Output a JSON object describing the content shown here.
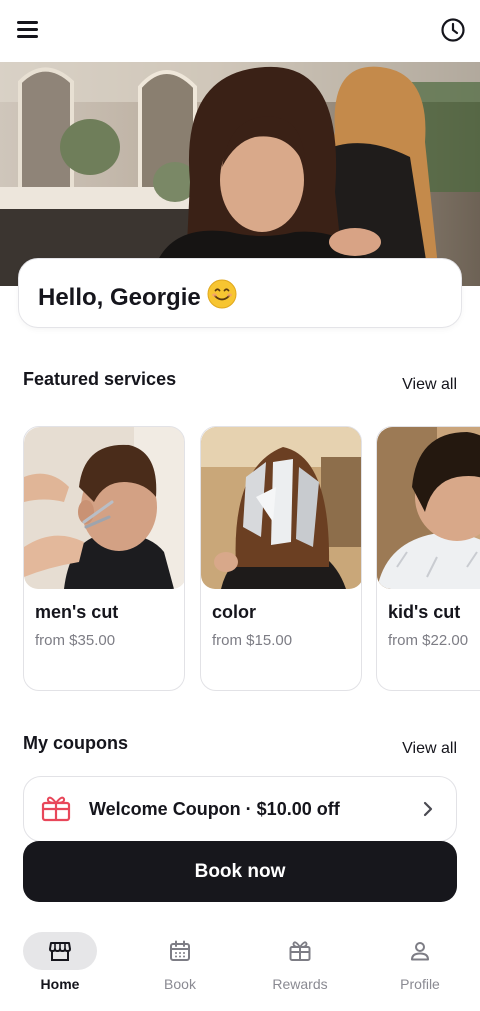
{
  "header": {
    "menu_icon": "hamburger-menu-icon",
    "history_icon": "clock-icon"
  },
  "greeting": {
    "text": "Hello, Georgie",
    "emoji_icon": "smiling-face-icon"
  },
  "featured": {
    "title": "Featured services",
    "view_all": "View all",
    "items": [
      {
        "name": "men's cut",
        "price": "from $35.00"
      },
      {
        "name": "color",
        "price": "from $15.00"
      },
      {
        "name": "kid's cut",
        "price": "from $22.00"
      }
    ]
  },
  "coupons": {
    "title": "My coupons",
    "view_all": "View all",
    "items": [
      {
        "label": "Welcome Coupon · $10.00 off",
        "icon": "gift-icon"
      }
    ]
  },
  "cta": {
    "book_now": "Book now"
  },
  "nav": {
    "items": [
      {
        "label": "Home",
        "icon": "store-icon",
        "active": true
      },
      {
        "label": "Book",
        "icon": "calendar-icon",
        "active": false
      },
      {
        "label": "Rewards",
        "icon": "gift-icon",
        "active": false
      },
      {
        "label": "Profile",
        "icon": "person-icon",
        "active": false
      }
    ]
  },
  "colors": {
    "accent": "#e8475a",
    "primary": "#17171c",
    "muted": "#7d7d85"
  }
}
